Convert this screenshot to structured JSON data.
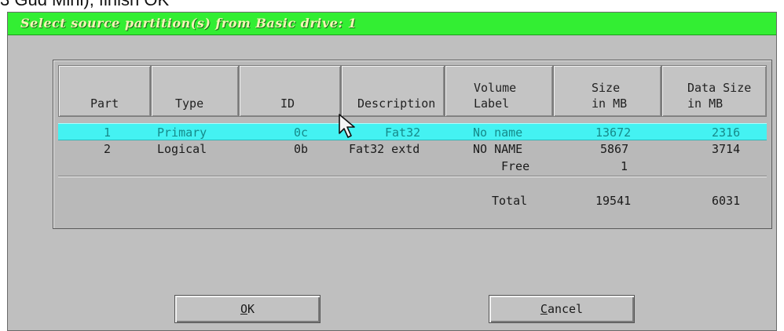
{
  "top_caption": "3 Gud Mini), finish OK",
  "dialog": {
    "title": "Select source partition(s) from Basic drive: 1"
  },
  "table": {
    "columns": [
      {
        "line1": "",
        "line2": "Part"
      },
      {
        "line1": "",
        "line2": "Type"
      },
      {
        "line1": "",
        "line2": "ID"
      },
      {
        "line1": "",
        "line2": "Description"
      },
      {
        "line1": "Volume",
        "line2": "Label"
      },
      {
        "line1": "Size",
        "line2": "in MB"
      },
      {
        "line1": "Data Size",
        "line2": "in MB"
      }
    ],
    "rows": [
      {
        "part": "1",
        "type": "Primary",
        "id": "0c",
        "description": "Fat32",
        "label": "No name",
        "size": "13672",
        "data_size": "2316",
        "selected": true
      },
      {
        "part": "2",
        "type": "Logical",
        "id": "0b",
        "description": "Fat32 extd",
        "label": "NO NAME",
        "size": "5867",
        "data_size": "3714",
        "selected": false
      },
      {
        "part": "",
        "type": "",
        "id": "",
        "description": "",
        "label": "Free",
        "size": "1",
        "data_size": "",
        "selected": false
      }
    ],
    "total": {
      "label": "Total",
      "size": "19541",
      "data_size": "6031"
    }
  },
  "buttons": {
    "ok": {
      "hotkey": "O",
      "rest": "K"
    },
    "cancel": {
      "hotkey": "C",
      "rest": "ancel"
    }
  },
  "colors": {
    "titlebar": "#33ee33",
    "selection": "#44f2f2",
    "dialog_bg": "#bfbfbf"
  },
  "icons": [
    "mouse-pointer-icon"
  ]
}
